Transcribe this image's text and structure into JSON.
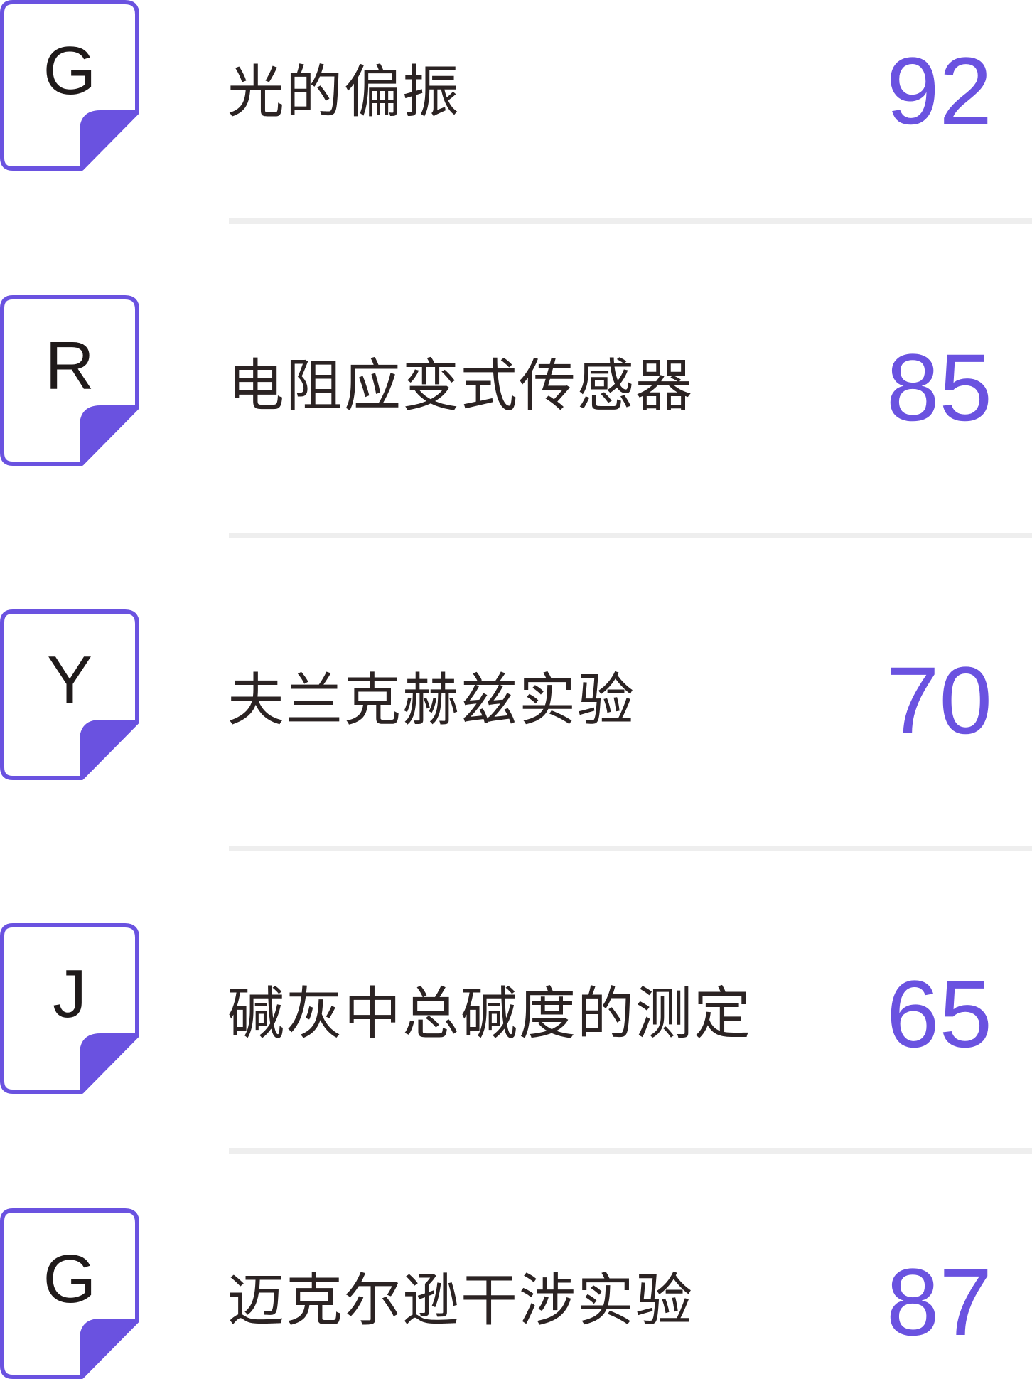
{
  "colors": {
    "accent": "#6a52e0",
    "title_text": "#2b2323",
    "divider": "#eeeeee",
    "background": "#ffffff"
  },
  "items": [
    {
      "letter": "G",
      "title": "光的偏振",
      "score": "92",
      "icon": "document-icon"
    },
    {
      "letter": "R",
      "title": "电阻应变式传感器",
      "score": "85",
      "icon": "document-icon"
    },
    {
      "letter": "Y",
      "title": "夫兰克赫兹实验",
      "score": "70",
      "icon": "document-icon"
    },
    {
      "letter": "J",
      "title": "碱灰中总碱度的测定",
      "score": "65",
      "icon": "document-icon"
    },
    {
      "letter": "G",
      "title": "迈克尔逊干涉实验",
      "score": "87",
      "icon": "document-icon"
    }
  ]
}
